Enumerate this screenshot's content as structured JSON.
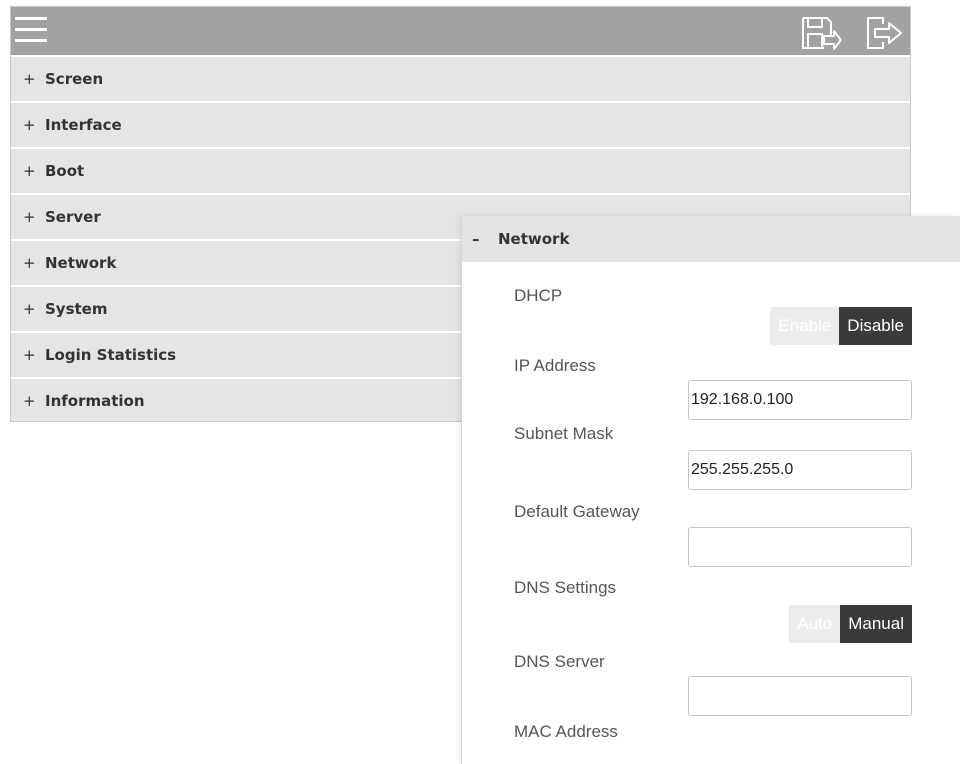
{
  "toolbar": {
    "menu_icon": "hamburger-menu-icon",
    "save_icon": "save-export-icon",
    "logout_icon": "logout-icon"
  },
  "menu": {
    "items": [
      {
        "sign": "+",
        "label": "Screen"
      },
      {
        "sign": "+",
        "label": "Interface"
      },
      {
        "sign": "+",
        "label": "Boot"
      },
      {
        "sign": "+",
        "label": "Server"
      },
      {
        "sign": "+",
        "label": "Network"
      },
      {
        "sign": "+",
        "label": "System"
      },
      {
        "sign": "+",
        "label": "Login Statistics"
      },
      {
        "sign": "+",
        "label": "Information"
      }
    ]
  },
  "network": {
    "sign": "–",
    "title": "Network",
    "dhcp": {
      "label": "DHCP",
      "options": [
        "Enable",
        "Disable"
      ],
      "selected": "Disable"
    },
    "ip_address": {
      "label": "IP Address",
      "value": "192.168.0.100"
    },
    "subnet_mask": {
      "label": "Subnet Mask",
      "value": "255.255.255.0"
    },
    "default_gateway": {
      "label": "Default Gateway",
      "value": ""
    },
    "dns_settings": {
      "label": "DNS Settings",
      "options": [
        "Auto",
        "Manual"
      ],
      "selected": "Manual"
    },
    "dns_server": {
      "label": "DNS Server",
      "value": ""
    },
    "mac_address": {
      "label": "MAC Address"
    }
  },
  "colors": {
    "topbar": "#a2a2a2",
    "menu_bg": "#e5e5e5",
    "toggle_active": "#3a3a3a",
    "toggle_inactive": "#ececec"
  }
}
